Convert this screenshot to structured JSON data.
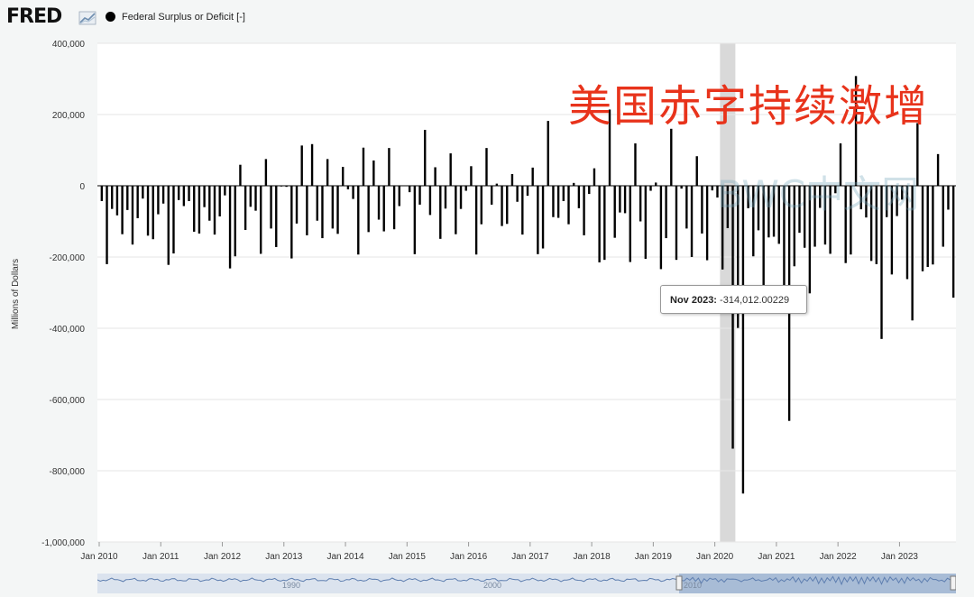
{
  "header": {
    "logo_text": "FRED",
    "logo_icon": "chart-line-icon",
    "series_label": "Federal Surplus or Deficit [-]",
    "series_color": "#000000"
  },
  "overlay": {
    "title_text": "美国赤字持续激增",
    "title_color": "#e8331b",
    "watermark_text": "BWC中文网"
  },
  "tooltip": {
    "date": "Nov 2023:",
    "value": "-314,012.00229"
  },
  "navigator": {
    "labels": [
      "1990",
      "2000",
      "2010"
    ]
  },
  "chart_data": {
    "type": "bar",
    "ylabel": "Millions of Dollars",
    "ylim": [
      -1000000,
      400000
    ],
    "y_ticks": [
      "400,000",
      "200,000",
      "0",
      "-200,000",
      "-400,000",
      "-600,000",
      "-800,000",
      "-1,000,000"
    ],
    "x_tick_labels": [
      "Jan 2010",
      "Jan 2011",
      "Jan 2012",
      "Jan 2013",
      "Jan 2014",
      "Jan 2015",
      "Jan 2016",
      "Jan 2017",
      "Jan 2018",
      "Jan 2019",
      "Jan 2020",
      "Jan 2021",
      "Jan 2022",
      "Jan 2023"
    ],
    "start": "2010-01",
    "recession_shading": [
      "2020-02",
      "2020-04"
    ],
    "highlight": "2023-11",
    "series": [
      {
        "name": "Federal Surplus or Deficit [-]",
        "values": [
          -43000,
          -220000,
          -65000,
          -83000,
          -136000,
          -68000,
          -165000,
          -91000,
          -36000,
          -140000,
          -150000,
          -80000,
          -50000,
          -222000,
          -190000,
          -40000,
          -57000,
          -43000,
          -129000,
          -134000,
          -60000,
          -98000,
          -137000,
          -86000,
          -27000,
          -232000,
          -198000,
          59000,
          -124000,
          -59000,
          -70000,
          -191000,
          75000,
          -120000,
          -172000,
          -1000,
          -3000,
          -204000,
          -106000,
          113000,
          -139000,
          117000,
          -98000,
          -147000,
          75000,
          -120000,
          -135000,
          53000,
          -10000,
          -37000,
          -193000,
          107000,
          -130000,
          71000,
          -95000,
          -128000,
          106000,
          -122000,
          -57000,
          1000,
          -18000,
          -192000,
          -53000,
          157000,
          -82000,
          52000,
          -149000,
          -64000,
          91000,
          -136000,
          -65000,
          -14000,
          55000,
          -193000,
          -108000,
          106000,
          -53000,
          6000,
          -113000,
          -107000,
          33000,
          -45000,
          -137000,
          -28000,
          51000,
          -192000,
          -176000,
          182000,
          -88000,
          -90000,
          -43000,
          -108000,
          8000,
          -63000,
          -139000,
          -23000,
          49000,
          -215000,
          -208000,
          214000,
          -146000,
          -75000,
          -77000,
          -214000,
          119000,
          -100000,
          -205000,
          -14000,
          9000,
          -234000,
          -147000,
          160000,
          -208000,
          -8000,
          -120000,
          -200000,
          83000,
          -134000,
          -209000,
          -13000,
          -33000,
          -235000,
          -119000,
          -738000,
          -399000,
          -864000,
          -63000,
          -198000,
          -125000,
          -284000,
          -145000,
          -143000,
          -163000,
          -311000,
          -660000,
          -226000,
          -132000,
          -174000,
          -302000,
          -171000,
          -62000,
          -165000,
          -191000,
          -21000,
          119000,
          -217000,
          -193000,
          308000,
          -66000,
          -89000,
          -211000,
          -220000,
          -430000,
          -88000,
          -249000,
          -85000,
          -39000,
          -262000,
          -378000,
          176000,
          -240000,
          -228000,
          -221000,
          89000,
          -171000,
          -67000,
          -314000
        ]
      }
    ]
  }
}
